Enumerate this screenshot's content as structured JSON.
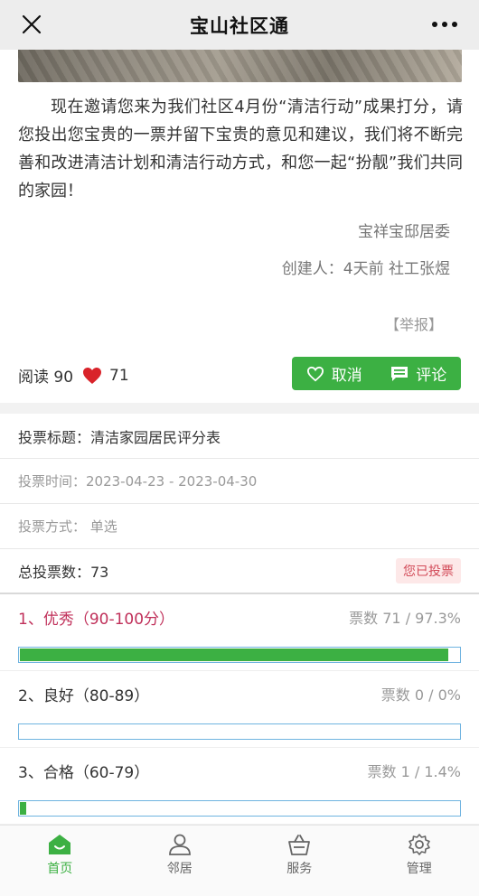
{
  "app": {
    "title": "宝山社区通"
  },
  "article": {
    "body": "现在邀请您来为我们社区4月份“清洁行动”成果打分，请您投出您宝贵的一票并留下宝贵的意见和建议，我们将不断完善和改进清洁计划和清洁行动方式，和您一起“扮靓”我们共同的家园！",
    "org": "宝祥宝邸居委",
    "creator": "创建人：4天前 社工张煜",
    "report": "【举报】",
    "read_label": "阅读 90",
    "likes": "71",
    "cancel_label": "取消",
    "comment_label": "评论"
  },
  "vote": {
    "title": "投票标题：清洁家园居民评分表",
    "time": "投票时间：2023-04-23 - 2023-04-30",
    "method": "投票方式：  单选",
    "total": "总投票数：73",
    "voted_badge": "您已投票",
    "options": [
      {
        "label": "1、优秀（90-100分）",
        "count": "票数 71 / 97.3%",
        "percent": 97.3,
        "selected": true
      },
      {
        "label": "2、良好（80-89）",
        "count": "票数 0 / 0%",
        "percent": 0,
        "selected": false
      },
      {
        "label": "3、合格（60-79）",
        "count": "票数 1 / 1.4%",
        "percent": 1.4,
        "selected": false
      }
    ]
  },
  "tabs": [
    {
      "label": "首页",
      "icon": "home-icon",
      "active": true
    },
    {
      "label": "邻居",
      "icon": "person-icon",
      "active": false
    },
    {
      "label": "服务",
      "icon": "basket-icon",
      "active": false
    },
    {
      "label": "管理",
      "icon": "gear-icon",
      "active": false
    }
  ],
  "colors": {
    "accent": "#3cb043",
    "selected_option": "#c0305a",
    "badge_text": "#d24a58"
  }
}
